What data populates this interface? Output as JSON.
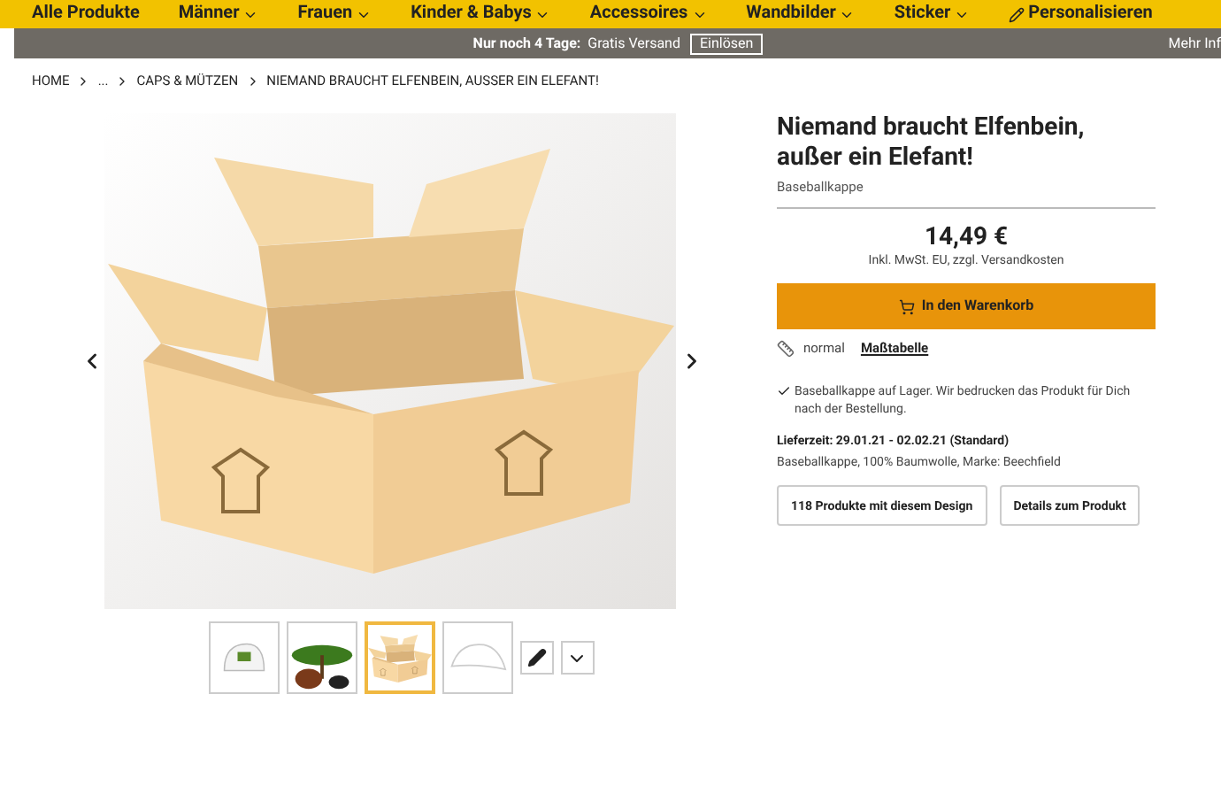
{
  "nav": [
    {
      "label": "Alle Produkte",
      "dropdown": false
    },
    {
      "label": "Männer",
      "dropdown": true
    },
    {
      "label": "Frauen",
      "dropdown": true
    },
    {
      "label": "Kinder & Babys",
      "dropdown": true
    },
    {
      "label": "Accessoires",
      "dropdown": true
    },
    {
      "label": "Wandbilder",
      "dropdown": true
    },
    {
      "label": "Sticker",
      "dropdown": true
    },
    {
      "label": "Personalisieren",
      "dropdown": false,
      "kind": "pencil"
    }
  ],
  "promo": {
    "strong": "Nur noch 4 Tage:",
    "text": "Gratis Versand",
    "button": "Einlösen",
    "more": "Mehr Inf"
  },
  "breadcrumb": [
    "HOME",
    "...",
    "CAPS & MÜTZEN",
    "NIEMAND BRAUCHT ELFENBEIN, AUSSER EIN ELEFANT!"
  ],
  "product": {
    "title": "Niemand braucht Elfenbein, außer ein Elefant!",
    "type": "Baseballkappe",
    "price": "14,49 €",
    "tax_note": "Inkl. MwSt. EU, zzgl. Versandkosten",
    "cart_button": "In den Warenkorb",
    "size": "normal",
    "size_chart": "Maßtabelle",
    "stock": "Baseballkappe auf Lager. Wir bedrucken das Produkt für Dich nach der Bestellung.",
    "delivery": "Lieferzeit: 29.01.21 - 02.02.21 (Standard)",
    "details": "Baseballkappe, 100% Baumwolle, Marke: Beechfield",
    "buttons": [
      "118 Produkte mit diesem Design",
      "Details zum Produkt"
    ]
  },
  "thumbnails": [
    {
      "kind": "cap-print",
      "selected": false
    },
    {
      "kind": "design",
      "selected": false
    },
    {
      "kind": "box",
      "selected": true
    },
    {
      "kind": "cap",
      "selected": false
    }
  ]
}
